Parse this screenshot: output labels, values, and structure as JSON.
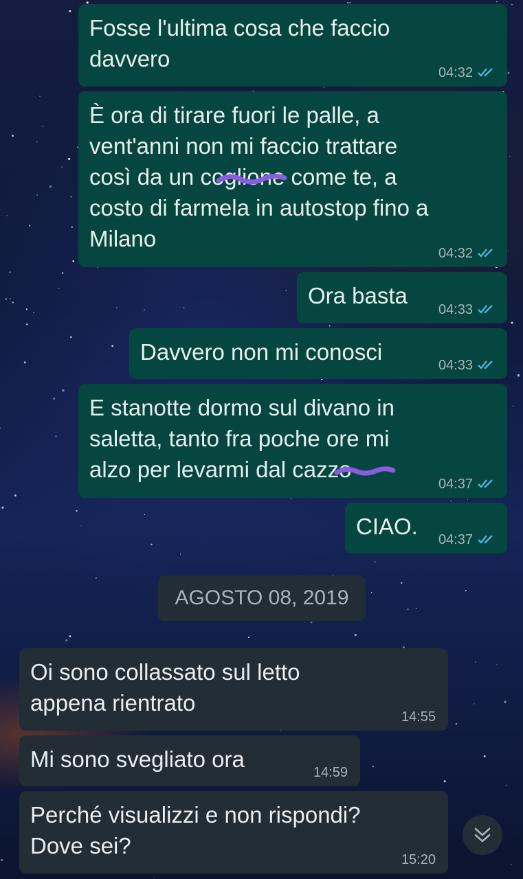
{
  "colors": {
    "outgoing_bubble": "#054740",
    "incoming_bubble": "#232d35",
    "text": "#e9edef",
    "timestamp": "#a8b3b8",
    "read_ticks": "#53bdeb",
    "redaction_scribble": "#8c5ce0"
  },
  "messages": [
    {
      "direction": "outgoing",
      "text": "Fosse l'ultima cosa che faccio\ndavvero",
      "time": "04:32",
      "status_icon": "double-check-read-icon"
    },
    {
      "direction": "outgoing",
      "text": "È ora di tirare fuori le palle, a\nvent'anni non mi faccio trattare\ncosì da un coglione come te, a\ncosto di farmela in autostop fino a\nMilano",
      "time": "04:32",
      "status_icon": "double-check-read-icon"
    },
    {
      "direction": "outgoing",
      "text": "Ora basta",
      "time": "04:33",
      "status_icon": "double-check-read-icon"
    },
    {
      "direction": "outgoing",
      "text": "Davvero non mi conosci",
      "time": "04:33",
      "status_icon": "double-check-read-icon"
    },
    {
      "direction": "outgoing",
      "text": "E stanotte dormo sul divano in\nsaletta, tanto fra poche ore mi\nalzo per levarmi dal cazzo",
      "time": "04:37",
      "status_icon": "double-check-read-icon"
    },
    {
      "direction": "outgoing",
      "text": "CIAO.",
      "time": "04:37",
      "status_icon": "double-check-read-icon"
    },
    {
      "direction": "incoming",
      "text": "Oi sono collassato sul letto\nappena rientrato",
      "time": "14:55"
    },
    {
      "direction": "incoming",
      "text": "Mi sono svegliato ora",
      "time": "14:59"
    },
    {
      "direction": "incoming",
      "text": "Perché visualizzi e non rispondi?\nDove sei?",
      "time": "15:20"
    }
  ],
  "date_separator": "AGOSTO 08, 2019",
  "scroll_button_icon": "chevron-double-down-icon"
}
